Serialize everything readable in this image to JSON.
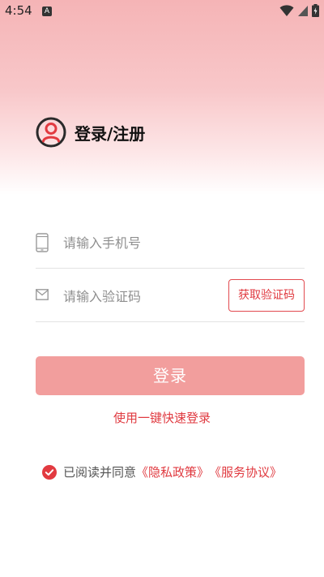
{
  "status_bar": {
    "time": "4:54",
    "notification_icon_letter": "A"
  },
  "header": {
    "title": "登录/注册",
    "avatar_icon": "user-circle-icon"
  },
  "phone_field": {
    "placeholder": "请输入手机号",
    "value": "",
    "icon": "phone-icon"
  },
  "code_field": {
    "placeholder": "请输入验证码",
    "value": "",
    "icon": "mail-icon",
    "get_code_label": "获取验证码"
  },
  "login_button": {
    "label": "登录"
  },
  "quick_login": {
    "label": "使用一键快速登录"
  },
  "agreement": {
    "checked": true,
    "text": "已阅读并同意",
    "privacy_link": "《隐私政策》",
    "service_link": "《服务协议》"
  },
  "colors": {
    "accent": "#e03a40",
    "button_bg": "#f29e9d",
    "gradient_top": "#f5b4b6"
  }
}
